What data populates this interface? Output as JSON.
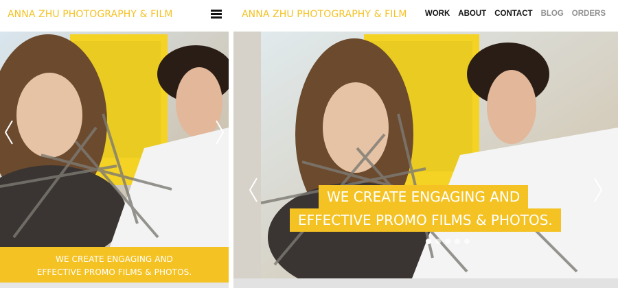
{
  "colors": {
    "brand_yellow": "#f4c223",
    "nav_dark": "#111111",
    "nav_muted": "#8f8f8f"
  },
  "mobile": {
    "brand": "ANNA ZHU PHOTOGRAPHY & FILM",
    "banner": {
      "line1": "WE CREATE ENGAGING AND",
      "line2": "EFFECTIVE PROMO FILMS & PHOTOS."
    }
  },
  "desktop": {
    "brand": "ANNA ZHU PHOTOGRAPHY & FILM",
    "nav": [
      {
        "label": "WORK",
        "color": "#111111"
      },
      {
        "label": "ABOUT",
        "color": "#111111"
      },
      {
        "label": "CONTACT",
        "color": "#111111"
      },
      {
        "label": "BLOG",
        "color": "#8f8f8f"
      },
      {
        "label": "ORDERS",
        "color": "#8f8f8f"
      }
    ],
    "caption": {
      "line1": "WE CREATE ENGAGING AND",
      "line2": "EFFECTIVE PROMO FILMS & PHOTOS."
    },
    "slide_count": 5,
    "active_slide": 0
  },
  "icons": {
    "menu": "hamburger-menu-icon",
    "prev": "chevron-left-icon",
    "next": "chevron-right-icon"
  }
}
